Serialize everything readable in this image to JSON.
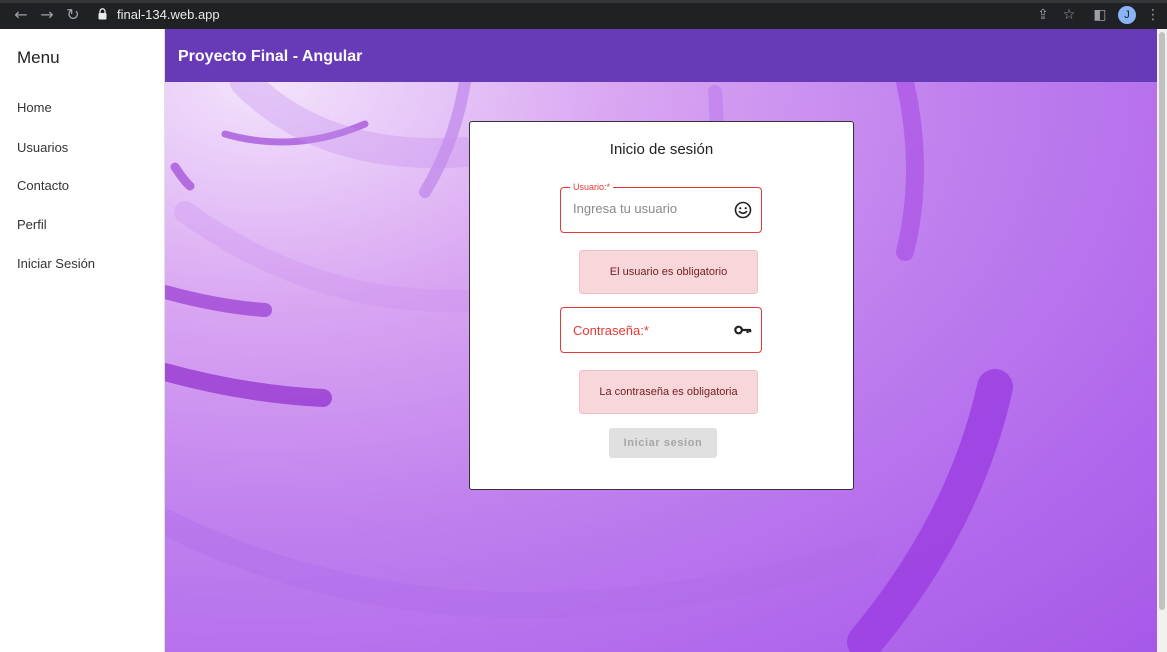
{
  "browser": {
    "url": "final-134.web.app",
    "profile_initial": "J"
  },
  "sidebar": {
    "title": "Menu",
    "items": [
      {
        "label": "Home"
      },
      {
        "label": "Usuarios"
      },
      {
        "label": "Contacto"
      },
      {
        "label": "Perfil"
      },
      {
        "label": "Iniciar Sesión"
      }
    ]
  },
  "header": {
    "title": "Proyecto Final - Angular"
  },
  "login": {
    "title": "Inicio de sesión",
    "username": {
      "label": "Usuario:*",
      "placeholder": "Ingresa tu usuario",
      "value": "",
      "icon": "smiley-face-icon",
      "error": "El usuario es obligatorio"
    },
    "password": {
      "label": "Contraseña:*",
      "value": "",
      "icon": "key-icon",
      "error": "La contraseña es obligatoria"
    },
    "submit_label": "Iniciar sesion",
    "submit_enabled": false
  },
  "colors": {
    "header": "#673ab7",
    "error": "#e53935",
    "alert_bg": "#f8d7da",
    "alert_text": "#721c24"
  }
}
